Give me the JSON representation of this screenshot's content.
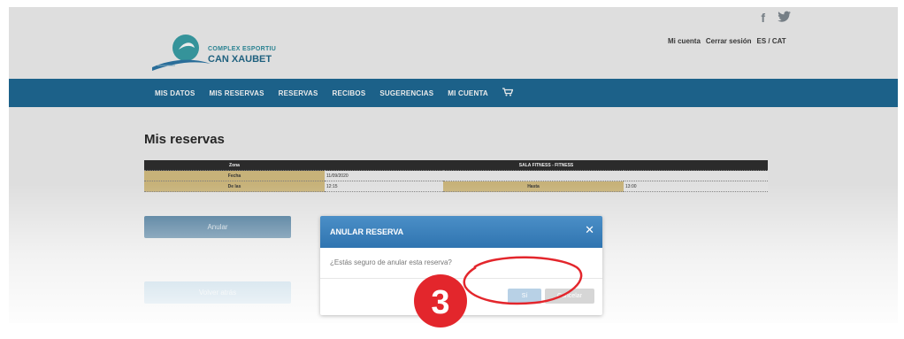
{
  "social": {
    "facebook": "f",
    "twitter": "🐦"
  },
  "top_links": {
    "account": "Mi cuenta",
    "logout": "Cerrar sesión",
    "language": "ES / CAT"
  },
  "logo": {
    "line1": "COMPLEX ESPORTIU",
    "line2": "CAN XAUBET"
  },
  "nav": {
    "items": [
      "MIS DATOS",
      "MIS RESERVAS",
      "RESERVAS",
      "RECIBOS",
      "SUGERENCIAS",
      "MI CUENTA"
    ],
    "cart_icon": "cart-icon"
  },
  "main": {
    "title": "Mis reservas",
    "table": {
      "zona_label": "Zona",
      "zona_value": "SALA FITNESS - FITNESS",
      "fecha_label": "Fecha",
      "fecha_value": "11/09/2020",
      "desde_label": "De las",
      "desde_value": "12:15",
      "hasta_label": "Hasta",
      "hasta_value": "13:00"
    },
    "anular_button": "Anular",
    "volver_button": "Volver atrás"
  },
  "modal": {
    "title": "ANULAR RESERVA",
    "close": "✕",
    "message": "¿Estás seguro de anular esta reserva?",
    "yes_button": "Sí",
    "cancel_button": "Cancelar"
  },
  "annotation": {
    "step_number": "3",
    "color": "#e3262c"
  }
}
